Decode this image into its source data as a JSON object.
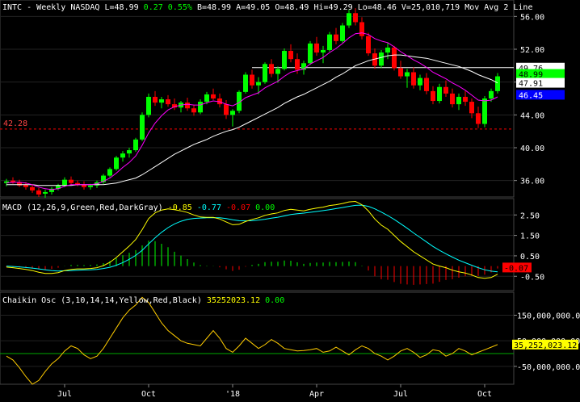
{
  "header": {
    "symbol": "INTC",
    "interval": "Weekly",
    "exchange": "NASDAQ",
    "L": "L=48.99",
    "chg": "0.27",
    "chg_pct": "0.55%",
    "B": "B=48.99",
    "A": "A=49.05",
    "O": "O=48.49",
    "Hi": "Hi=49.29",
    "Lo": "Lo=48.46",
    "V": "V=25,010,719",
    "study": "Mov Avg 2 Line"
  },
  "macd_header": {
    "label": "MACD (12,26,9,Green,Red,DarkGray)",
    "v1": "-0.85",
    "v2": "-0.77",
    "v3": "-0.07",
    "v4": "0.00"
  },
  "chaikin_header": {
    "label": "Chaikin Osc (3,10,14,14,Yellow,Red,Black)",
    "v1": "35252023.12",
    "v2": "0.00"
  },
  "price_axis": {
    "ticks": [
      "56.00",
      "52.00",
      "48.00",
      "44.00",
      "40.00",
      "36.00"
    ],
    "tags": [
      {
        "text": "49.76",
        "bg": "#ffffff",
        "fg": "#000000"
      },
      {
        "text": "48.99",
        "bg": "#00ff00",
        "fg": "#000000"
      },
      {
        "text": "47.91",
        "bg": "#ffffff",
        "fg": "#000000"
      },
      {
        "text": "46.45",
        "bg": "#0000ff",
        "fg": "#ffffff"
      }
    ],
    "support_label": "42.28"
  },
  "macd_axis": {
    "ticks": [
      "2.50",
      "1.50",
      "0.50",
      "-0.50"
    ],
    "tag": {
      "text": "-0.07",
      "bg": "#ff0000",
      "fg": "#000000"
    }
  },
  "chaikin_axis": {
    "ticks": [
      "150,000,000.00",
      "50,000,000.00",
      "-50,000,000.00"
    ],
    "tag": {
      "text": "35,252,023.12",
      "bg": "#ffff00",
      "fg": "#000000"
    }
  },
  "x_axis": {
    "labels": [
      {
        "text": "Jul",
        "week": 9
      },
      {
        "text": "Oct",
        "week": 22
      },
      {
        "text": "'18",
        "week": 35
      },
      {
        "text": "Apr",
        "week": 48
      },
      {
        "text": "Jul",
        "week": 61
      },
      {
        "text": "Oct",
        "week": 74
      }
    ]
  },
  "colors": {
    "up": "#00ff00",
    "down": "#ff0000",
    "ma_fast": "#ff00ff",
    "ma_slow": "#ffffff",
    "grid": "#222222",
    "support": "#ff0000",
    "macd_line": "#ffff00",
    "signal_line": "#00ffff",
    "hist_pos": "#00ff00",
    "hist_neg": "#ff0000",
    "chaikin_line": "#ffcc00",
    "zero_line": "#00aa00"
  },
  "chart_data": [
    {
      "type": "candlestick",
      "title": "INTC - Weekly NASDAQ",
      "ylim": [
        34,
        58
      ],
      "support_level": 42.28,
      "resistance_level": 49.76,
      "series": [
        {
          "name": "INTC",
          "ohlc": [
            [
              35.7,
              36.2,
              35.3,
              35.9
            ],
            [
              36.0,
              36.4,
              35.6,
              35.8
            ],
            [
              35.8,
              36.1,
              35.2,
              35.4
            ],
            [
              35.5,
              35.8,
              34.9,
              35.2
            ],
            [
              35.2,
              35.5,
              34.5,
              34.8
            ],
            [
              34.8,
              35.1,
              34.0,
              34.3
            ],
            [
              34.4,
              34.9,
              33.9,
              34.6
            ],
            [
              34.6,
              35.2,
              34.3,
              35.0
            ],
            [
              35.0,
              35.6,
              34.8,
              35.4
            ],
            [
              35.4,
              36.4,
              35.2,
              36.1
            ],
            [
              36.1,
              36.5,
              35.5,
              35.7
            ],
            [
              35.7,
              36.0,
              35.3,
              35.5
            ],
            [
              35.5,
              35.9,
              34.9,
              35.2
            ],
            [
              35.2,
              35.6,
              34.9,
              35.4
            ],
            [
              35.4,
              36.0,
              35.1,
              35.8
            ],
            [
              35.8,
              36.8,
              35.6,
              36.6
            ],
            [
              36.6,
              37.6,
              36.4,
              37.4
            ],
            [
              37.4,
              39.0,
              37.2,
              38.8
            ],
            [
              38.8,
              39.6,
              38.3,
              39.3
            ],
            [
              39.3,
              40.0,
              38.8,
              39.7
            ],
            [
              39.7,
              41.2,
              39.5,
              41.0
            ],
            [
              41.0,
              44.3,
              40.8,
              44.0
            ],
            [
              44.0,
              46.6,
              43.7,
              46.2
            ],
            [
              46.2,
              46.9,
              45.1,
              45.5
            ],
            [
              45.5,
              46.2,
              44.8,
              45.9
            ],
            [
              45.9,
              46.4,
              45.0,
              45.3
            ],
            [
              45.3,
              46.0,
              44.6,
              44.9
            ],
            [
              44.9,
              45.7,
              44.3,
              45.5
            ],
            [
              45.5,
              46.1,
              44.5,
              44.8
            ],
            [
              44.8,
              45.2,
              43.9,
              44.3
            ],
            [
              44.3,
              45.9,
              44.1,
              45.6
            ],
            [
              45.6,
              46.8,
              45.3,
              46.5
            ],
            [
              46.5,
              47.2,
              45.8,
              46.0
            ],
            [
              46.0,
              46.6,
              44.9,
              45.3
            ],
            [
              45.3,
              45.8,
              43.5,
              44.0
            ],
            [
              44.0,
              44.7,
              42.6,
              44.5
            ],
            [
              44.5,
              47.0,
              44.2,
              46.8
            ],
            [
              46.8,
              49.2,
              46.6,
              48.9
            ],
            [
              48.9,
              49.5,
              47.2,
              47.6
            ],
            [
              47.6,
              48.6,
              46.5,
              48.0
            ],
            [
              48.0,
              50.4,
              47.8,
              50.2
            ],
            [
              50.2,
              50.8,
              48.6,
              49.0
            ],
            [
              49.0,
              49.9,
              47.9,
              49.6
            ],
            [
              49.6,
              52.1,
              49.4,
              51.8
            ],
            [
              51.8,
              52.6,
              50.4,
              50.8
            ],
            [
              50.8,
              51.5,
              49.0,
              49.5
            ],
            [
              49.5,
              50.6,
              48.9,
              50.3
            ],
            [
              50.3,
              53.0,
              50.1,
              52.7
            ],
            [
              52.7,
              53.5,
              51.2,
              51.6
            ],
            [
              51.6,
              52.4,
              50.3,
              51.9
            ],
            [
              51.9,
              54.1,
              51.7,
              53.8
            ],
            [
              53.8,
              54.6,
              52.6,
              53.0
            ],
            [
              53.0,
              55.2,
              52.8,
              54.9
            ],
            [
              54.9,
              56.8,
              54.6,
              56.4
            ],
            [
              56.4,
              57.0,
              54.9,
              55.3
            ],
            [
              55.3,
              55.9,
              53.2,
              53.6
            ],
            [
              53.6,
              54.0,
              51.2,
              51.5
            ],
            [
              51.5,
              52.1,
              49.6,
              50.0
            ],
            [
              50.0,
              51.9,
              49.7,
              51.6
            ],
            [
              51.6,
              52.8,
              50.8,
              52.2
            ],
            [
              52.2,
              52.4,
              49.4,
              49.7
            ],
            [
              49.7,
              50.6,
              48.4,
              48.7
            ],
            [
              48.7,
              49.6,
              47.3,
              49.2
            ],
            [
              49.2,
              49.8,
              47.2,
              47.6
            ],
            [
              47.6,
              48.9,
              47.0,
              48.5
            ],
            [
              48.5,
              49.1,
              46.5,
              46.9
            ],
            [
              46.9,
              47.5,
              45.3,
              45.7
            ],
            [
              45.7,
              47.8,
              45.4,
              47.4
            ],
            [
              47.4,
              48.2,
              46.2,
              46.6
            ],
            [
              46.6,
              47.2,
              44.9,
              45.3
            ],
            [
              45.3,
              46.6,
              44.6,
              46.2
            ],
            [
              46.2,
              46.9,
              45.1,
              45.6
            ],
            [
              45.6,
              46.0,
              43.6,
              44.2
            ],
            [
              44.2,
              45.0,
              42.4,
              42.9
            ],
            [
              42.9,
              46.3,
              42.5,
              46.0
            ],
            [
              46.0,
              47.2,
              45.6,
              46.9
            ],
            [
              46.9,
              49.1,
              46.6,
              48.7
            ]
          ]
        },
        {
          "name": "Mov Avg fast",
          "values": [
            35.7,
            35.8,
            35.8,
            35.7,
            35.5,
            35.2,
            35.0,
            34.9,
            35.0,
            35.3,
            35.5,
            35.5,
            35.5,
            35.5,
            35.6,
            35.9,
            36.3,
            36.9,
            37.6,
            38.2,
            39.0,
            40.3,
            41.8,
            43.0,
            43.9,
            44.6,
            45.0,
            45.2,
            45.3,
            45.2,
            45.2,
            45.5,
            45.7,
            45.6,
            45.3,
            45.1,
            45.5,
            46.1,
            46.4,
            46.7,
            47.3,
            47.7,
            48.1,
            48.7,
            49.2,
            49.4,
            49.6,
            50.2,
            50.6,
            51.0,
            51.6,
            52.1,
            52.7,
            53.4,
            53.9,
            54.0,
            53.8,
            53.3,
            53.0,
            52.8,
            52.3,
            51.7,
            51.2,
            50.7,
            50.3,
            49.8,
            49.2,
            48.8,
            48.4,
            47.9,
            47.5,
            47.0,
            46.4,
            45.8,
            45.7,
            45.8,
            46.2
          ]
        },
        {
          "name": "Mov Avg slow",
          "values": [
            35.5,
            35.5,
            35.5,
            35.5,
            35.5,
            35.4,
            35.4,
            35.4,
            35.4,
            35.4,
            35.4,
            35.5,
            35.5,
            35.5,
            35.5,
            35.5,
            35.6,
            35.7,
            35.9,
            36.1,
            36.3,
            36.7,
            37.2,
            37.7,
            38.2,
            38.7,
            39.2,
            39.6,
            40.0,
            40.4,
            40.7,
            41.0,
            41.4,
            41.7,
            42.0,
            42.2,
            42.5,
            42.9,
            43.3,
            43.7,
            44.1,
            44.5,
            44.9,
            45.4,
            45.8,
            46.2,
            46.5,
            46.9,
            47.3,
            47.7,
            48.1,
            48.6,
            49.0,
            49.5,
            50.0,
            50.3,
            50.6,
            50.8,
            51.0,
            51.2,
            51.3,
            51.3,
            51.2,
            51.1,
            51.0,
            50.9,
            50.7,
            50.5,
            50.3,
            50.1,
            49.9,
            49.6,
            49.3,
            48.9,
            48.6,
            48.3,
            47.9
          ]
        }
      ]
    },
    {
      "type": "line",
      "title": "MACD (12,26,9,Green,Red,DarkGray)",
      "ylim": [
        -1.2,
        3.3
      ],
      "series": [
        {
          "name": "MACD",
          "values": [
            -0.05,
            -0.08,
            -0.12,
            -0.16,
            -0.22,
            -0.3,
            -0.36,
            -0.36,
            -0.32,
            -0.22,
            -0.16,
            -0.14,
            -0.14,
            -0.12,
            -0.08,
            0.02,
            0.18,
            0.42,
            0.7,
            0.98,
            1.3,
            1.78,
            2.32,
            2.6,
            2.74,
            2.8,
            2.76,
            2.7,
            2.62,
            2.5,
            2.4,
            2.38,
            2.38,
            2.3,
            2.16,
            2.02,
            2.04,
            2.18,
            2.28,
            2.36,
            2.48,
            2.55,
            2.6,
            2.72,
            2.78,
            2.74,
            2.7,
            2.78,
            2.84,
            2.88,
            2.96,
            3.0,
            3.06,
            3.14,
            3.16,
            3.0,
            2.7,
            2.3,
            2.0,
            1.8,
            1.5,
            1.2,
            0.95,
            0.7,
            0.5,
            0.3,
            0.1,
            0.0,
            -0.08,
            -0.2,
            -0.28,
            -0.34,
            -0.44,
            -0.56,
            -0.6,
            -0.56,
            -0.4
          ]
        },
        {
          "name": "Signal",
          "values": [
            0.0,
            -0.02,
            -0.04,
            -0.07,
            -0.1,
            -0.14,
            -0.18,
            -0.22,
            -0.24,
            -0.23,
            -0.22,
            -0.2,
            -0.19,
            -0.18,
            -0.16,
            -0.12,
            -0.06,
            0.04,
            0.17,
            0.33,
            0.52,
            0.77,
            1.08,
            1.38,
            1.65,
            1.88,
            2.06,
            2.19,
            2.28,
            2.33,
            2.35,
            2.36,
            2.37,
            2.36,
            2.32,
            2.26,
            2.22,
            2.21,
            2.22,
            2.25,
            2.29,
            2.34,
            2.39,
            2.45,
            2.52,
            2.56,
            2.59,
            2.63,
            2.67,
            2.71,
            2.76,
            2.81,
            2.86,
            2.92,
            2.97,
            2.98,
            2.92,
            2.8,
            2.64,
            2.47,
            2.28,
            2.07,
            1.85,
            1.62,
            1.4,
            1.18,
            0.96,
            0.77,
            0.6,
            0.44,
            0.29,
            0.16,
            0.04,
            -0.08,
            -0.18,
            -0.25,
            -0.28
          ]
        }
      ]
    },
    {
      "type": "line",
      "title": "Chaikin Osc (3,10,14,14,Yellow,Red,Black)",
      "ylim": [
        -120000000,
        240000000
      ],
      "series": [
        {
          "name": "Chaikin Osc",
          "values": [
            -10000000,
            -25000000,
            -55000000,
            -90000000,
            -120000000,
            -105000000,
            -70000000,
            -40000000,
            -20000000,
            10000000,
            30000000,
            20000000,
            -5000000,
            -20000000,
            -10000000,
            20000000,
            60000000,
            100000000,
            140000000,
            170000000,
            190000000,
            220000000,
            200000000,
            160000000,
            120000000,
            90000000,
            70000000,
            50000000,
            40000000,
            35000000,
            30000000,
            60000000,
            90000000,
            60000000,
            20000000,
            5000000,
            30000000,
            60000000,
            40000000,
            20000000,
            35000000,
            55000000,
            40000000,
            20000000,
            15000000,
            10000000,
            12000000,
            15000000,
            20000000,
            5000000,
            10000000,
            25000000,
            10000000,
            -5000000,
            15000000,
            30000000,
            20000000,
            0,
            -10000000,
            -25000000,
            -10000000,
            10000000,
            20000000,
            5000000,
            -15000000,
            -5000000,
            15000000,
            10000000,
            -10000000,
            0,
            20000000,
            10000000,
            -5000000,
            5000000,
            15000000,
            25000000,
            35252023
          ]
        }
      ]
    }
  ]
}
